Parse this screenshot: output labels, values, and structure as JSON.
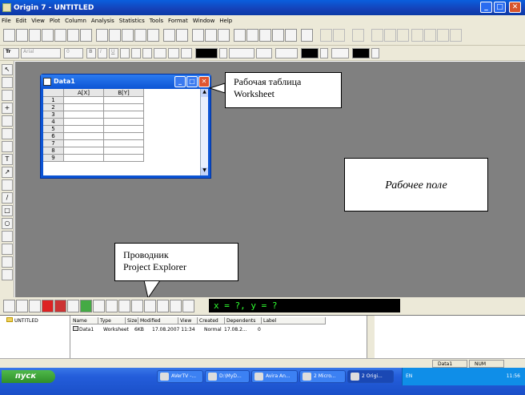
{
  "window": {
    "title": "Origin 7 - UNTITLED",
    "min_glyph": "_",
    "max_glyph": "□",
    "close_glyph": "✕"
  },
  "menu": [
    "File",
    "Edit",
    "View",
    "Plot",
    "Column",
    "Analysis",
    "Statistics",
    "Tools",
    "Format",
    "Window",
    "Help"
  ],
  "format_toolbar": {
    "font_button": "Tr",
    "font_value": "Arial",
    "size_value": "0",
    "bold": "B",
    "italic": "I",
    "underline": "U"
  },
  "worksheet": {
    "title": "Data1",
    "columns": [
      "A[X]",
      "B[Y]"
    ],
    "rows": [
      "1",
      "2",
      "3",
      "4",
      "5",
      "6",
      "7",
      "8",
      "9"
    ]
  },
  "callouts": {
    "worksheet": [
      "Рабочая таблица",
      "Worksheet"
    ],
    "project_explorer": [
      "Проводник",
      "Project Explorer"
    ],
    "workfield": "Рабочее поле"
  },
  "coordinates": "x = ?, y = ?",
  "project_explorer": {
    "folder": "UNTITLED",
    "headers": [
      "Name",
      "Type",
      "Size",
      "Modified",
      "View",
      "Created",
      "Dependents",
      "Label"
    ],
    "items": [
      {
        "name": "Data1",
        "type": "Worksheet",
        "size": "6KB",
        "modified": "17.08.2007 11:34",
        "view": "Normal",
        "created": "17.08.2...",
        "dependents": "0",
        "label": ""
      }
    ]
  },
  "status": {
    "window": "Data1",
    "mode": "NUM"
  },
  "taskbar": {
    "start": "пуск",
    "tasks": [
      "AVerTV -...",
      "D:\\MyD...",
      "Avira An...",
      "2 Micro...",
      "2 Origi..."
    ],
    "lang": "EN",
    "clock": "11:56"
  },
  "colors": {
    "xp_blue": "#0b54d4",
    "workspace": "#808080",
    "coord_text": "#30ff30"
  }
}
